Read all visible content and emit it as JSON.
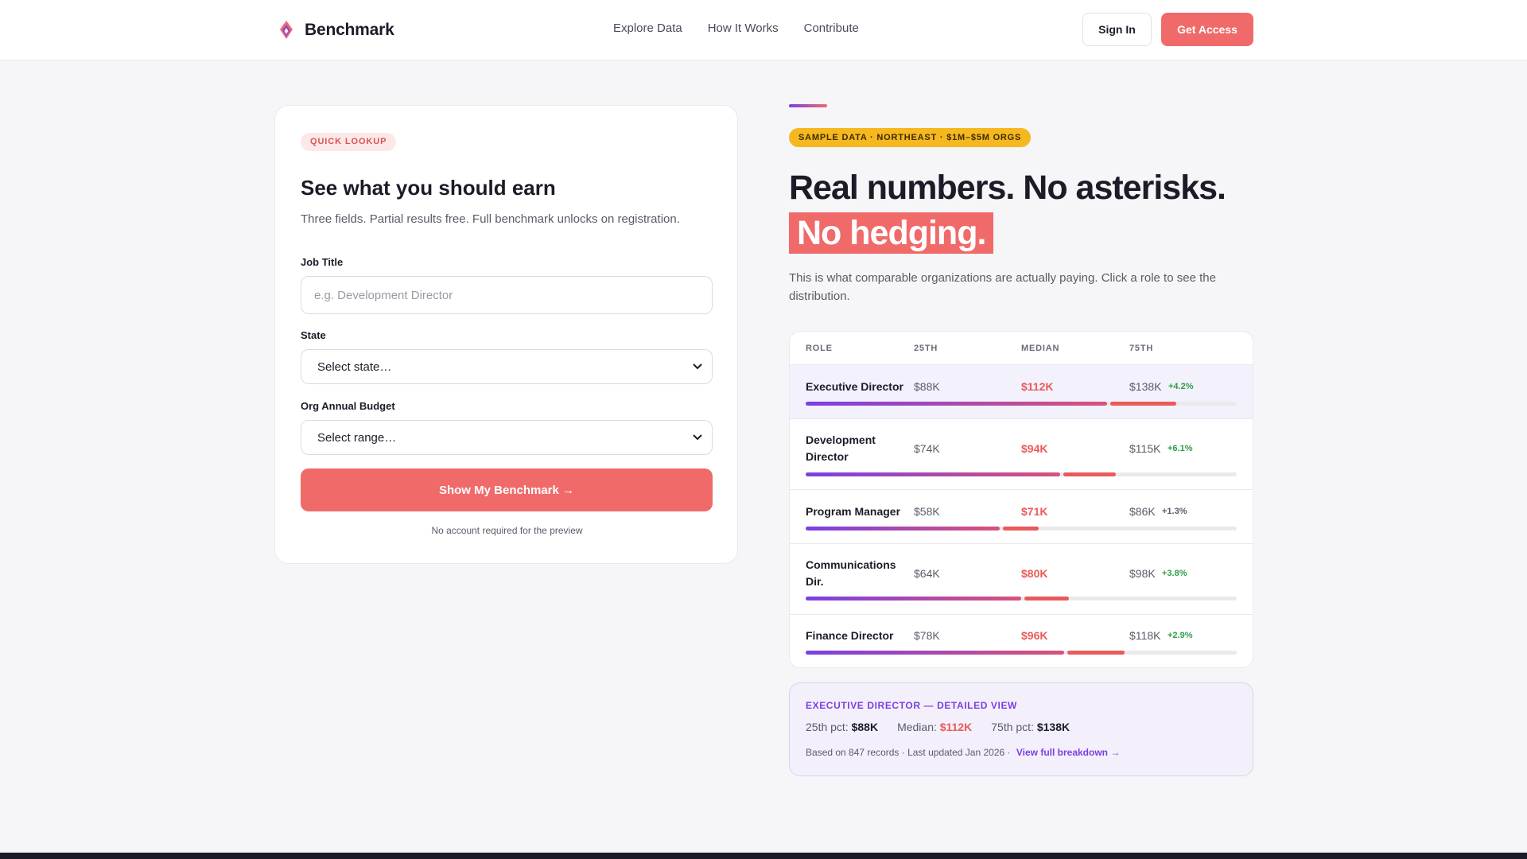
{
  "header": {
    "brand": "Benchmark",
    "nav": [
      "Explore Data",
      "How It Works",
      "Contribute"
    ],
    "sign_in": "Sign In",
    "get_access": "Get Access"
  },
  "form": {
    "badge": "QUICK LOOKUP",
    "title": "See what you should earn",
    "subtitle": "Three fields. Partial results free. Full benchmark unlocks on registration.",
    "job_title_label": "Job Title",
    "job_title_placeholder": "e.g. Development Director",
    "state_label": "State",
    "state_value": "Select state…",
    "budget_label": "Org Annual Budget",
    "budget_value": "Select range…",
    "submit": "Show My Benchmark →",
    "note": "No account required for the preview"
  },
  "hero": {
    "badge": "SAMPLE DATA · NORTHEAST · $1M–$5M ORGS",
    "headline_1": "Real numbers. No asterisks.",
    "headline_2": "No hedging.",
    "description": "This is what comparable organizations are actually paying. Click a role to see the distribution."
  },
  "table": {
    "headers": [
      "ROLE",
      "25TH",
      "MEDIAN",
      "75TH"
    ],
    "rows": [
      {
        "role": "Executive Director",
        "p25": "$88K",
        "median": "$112K",
        "p75": "$138K",
        "change": "+4.2%",
        "bar_p25": 0.7,
        "bar_median": 0.86
      },
      {
        "role": "Development Director",
        "p25": "$74K",
        "median": "$94K",
        "p75": "$115K",
        "change": "+6.1%",
        "bar_p25": 0.59,
        "bar_median": 0.72
      },
      {
        "role": "Program Manager",
        "p25": "$58K",
        "median": "$71K",
        "p75": "$86K",
        "change": "+1.3%",
        "bar_p25": 0.45,
        "bar_median": 0.54
      },
      {
        "role": "Communications Dir.",
        "p25": "$64K",
        "median": "$80K",
        "p75": "$98K",
        "change": "+3.8%",
        "bar_p25": 0.5,
        "bar_median": 0.61
      },
      {
        "role": "Finance Director",
        "p25": "$78K",
        "median": "$96K",
        "p75": "$118K",
        "change": "+2.9%",
        "bar_p25": 0.6,
        "bar_median": 0.74
      }
    ]
  },
  "detail": {
    "title": "EXECUTIVE DIRECTOR — DETAILED VIEW",
    "p25_label": "25th pct:",
    "p25": "$88K",
    "median_label": "Median:",
    "median": "$112K",
    "p75_label": "75th pct:",
    "p75": "$138K",
    "meta": "Based on 847 records · Last updated Jan 2026 ·",
    "link": "View full breakdown →"
  },
  "colors": {
    "accent": "#f06a6a",
    "purple": "#7b3fe4",
    "highlight": "#f6b81f",
    "positive": "#2f9e4a"
  }
}
